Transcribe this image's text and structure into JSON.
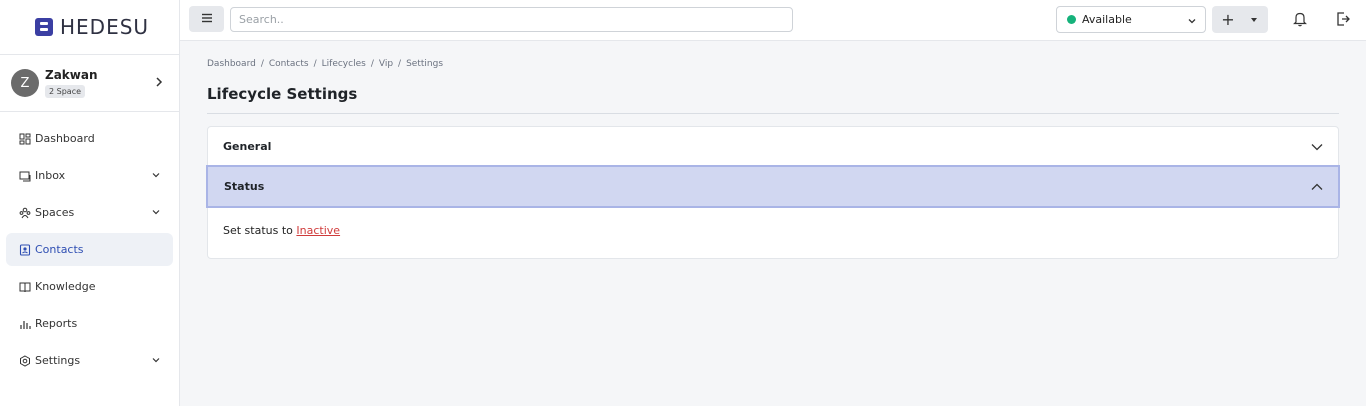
{
  "brand": {
    "name": "HEDESU"
  },
  "user": {
    "initial": "Z",
    "name": "Zakwan",
    "badge": "2 Space"
  },
  "sidebar": {
    "items": [
      {
        "label": "Dashboard",
        "icon": "dashboard-icon",
        "has_caret": false
      },
      {
        "label": "Inbox",
        "icon": "inbox-icon",
        "has_caret": true
      },
      {
        "label": "Spaces",
        "icon": "spaces-icon",
        "has_caret": true
      },
      {
        "label": "Contacts",
        "icon": "contacts-icon",
        "has_caret": false,
        "active": true
      },
      {
        "label": "Knowledge",
        "icon": "book-icon",
        "has_caret": false
      },
      {
        "label": "Reports",
        "icon": "bar-chart-icon",
        "has_caret": false
      },
      {
        "label": "Settings",
        "icon": "gear-icon",
        "has_caret": true
      }
    ]
  },
  "topbar": {
    "search_placeholder": "Search..",
    "status_value": "Available",
    "status_color": "#16b27b",
    "add_label": "+"
  },
  "breadcrumb": [
    "Dashboard",
    "Contacts",
    "Lifecycles",
    "Vip",
    "Settings"
  ],
  "page": {
    "title": "Lifecycle Settings"
  },
  "accordion": {
    "general": {
      "title": "General"
    },
    "status": {
      "title": "Status",
      "body_text": "Set status to",
      "link_text": "Inactive"
    }
  },
  "colors": {
    "accent": "#2f4fb3",
    "active_bg": "#eef1f6",
    "open_header_bg": "#d1d7f1",
    "link": "#d03b3b"
  }
}
